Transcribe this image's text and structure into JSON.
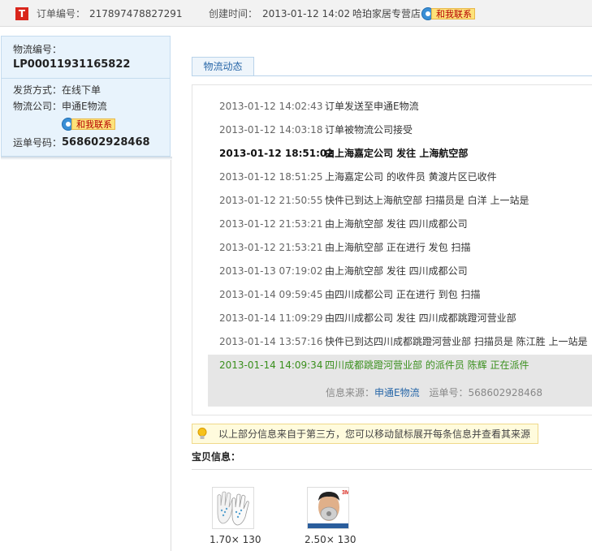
{
  "header": {
    "logo_letter": "T",
    "order_label": "订单编号：",
    "order_no": "217897478827291",
    "created_label": "创建时间：",
    "created_time": "2013-01-12 14:02",
    "shop_name": "哈珀家居专营店",
    "contact_label": "和我联系"
  },
  "sidebar": {
    "logistics_no_label": "物流编号：",
    "logistics_no": "LP00011931165822",
    "ship_method_label": "发货方式：",
    "ship_method": "在线下单",
    "company_label": "物流公司：",
    "company": "申通E物流",
    "contact_label": "和我联系",
    "waybill_label": "运单号码：",
    "waybill_no": "568602928468"
  },
  "tabs": [
    {
      "label": "物流动态"
    }
  ],
  "logs": [
    {
      "time": "2013-01-12 14:02:43",
      "text": "订单发送至申通E物流"
    },
    {
      "time": "2013-01-12 14:03:18",
      "text": "订单被物流公司接受"
    },
    {
      "time": "2013-01-12 18:51:02",
      "text": "由上海嘉定公司 发往 上海航空部"
    },
    {
      "time": "2013-01-12 18:51:25",
      "text": "上海嘉定公司 的收件员 黄渡片区已收件"
    },
    {
      "time": "2013-01-12 21:50:55",
      "text": "快件已到达上海航空部 扫描员是 白洋 上一站是"
    },
    {
      "time": "2013-01-12 21:53:21",
      "text": "由上海航空部 发往 四川成都公司"
    },
    {
      "time": "2013-01-12 21:53:21",
      "text": "由上海航空部 正在进行 发包 扫描"
    },
    {
      "time": "2013-01-13 07:19:02",
      "text": "由上海航空部 发往 四川成都公司"
    },
    {
      "time": "2013-01-14 09:59:45",
      "text": "由四川成都公司 正在进行 到包 扫描"
    },
    {
      "time": "2013-01-14 11:09:29",
      "text": "由四川成都公司 发往 四川成都跳蹬河营业部"
    },
    {
      "time": "2013-01-14 13:57:16",
      "text": "快件已到达四川成都跳蹬河营业部 扫描员是 陈江胜 上一站是"
    },
    {
      "time": "2013-01-14 14:09:34",
      "text": "四川成都跳蹬河营业部 的派件员 陈辉 正在派件"
    }
  ],
  "source": {
    "label": "信息来源：",
    "company": "申通E物流",
    "waybill_label": "运单号：",
    "waybill_no": "568602928468"
  },
  "tip": {
    "text": "以上部分信息来自于第三方，您可以移动鼠标展开每条信息并查看其来源"
  },
  "products": {
    "title": "宝贝信息：",
    "items": [
      {
        "icon": "gloves-image",
        "qty": "1.70× 130"
      },
      {
        "icon": "mask-image",
        "qty": "2.50× 130",
        "badge": "3M"
      }
    ]
  },
  "colors": {
    "brand_red": "#d9261c",
    "link_blue": "#2867a8",
    "latest_green": "#3a8f1d"
  }
}
